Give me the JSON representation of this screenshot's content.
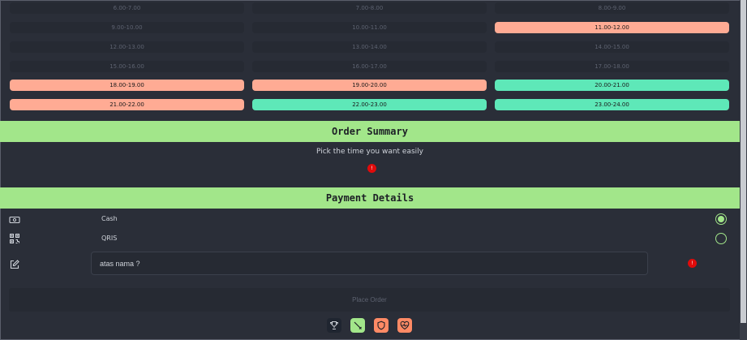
{
  "slots": [
    {
      "label": "6.00-7.00",
      "state": "disabled"
    },
    {
      "label": "7.00-8.00",
      "state": "disabled"
    },
    {
      "label": "8.00-9.00",
      "state": "disabled"
    },
    {
      "label": "9.00-10.00",
      "state": "disabled"
    },
    {
      "label": "10.00-11.00",
      "state": "disabled"
    },
    {
      "label": "11.00-12.00",
      "state": "booked"
    },
    {
      "label": "12.00-13.00",
      "state": "disabled"
    },
    {
      "label": "13.00-14.00",
      "state": "disabled"
    },
    {
      "label": "14.00-15.00",
      "state": "disabled"
    },
    {
      "label": "15.00-16.00",
      "state": "disabled"
    },
    {
      "label": "16.00-17.00",
      "state": "disabled"
    },
    {
      "label": "17.00-18.00",
      "state": "disabled"
    },
    {
      "label": "18.00-19.00",
      "state": "booked"
    },
    {
      "label": "19.00-20.00",
      "state": "booked"
    },
    {
      "label": "20.00-21.00",
      "state": "open"
    },
    {
      "label": "21.00-22.00",
      "state": "booked"
    },
    {
      "label": "22.00-23.00",
      "state": "open"
    },
    {
      "label": "23.00-24.00",
      "state": "open"
    }
  ],
  "order_summary": {
    "title": "Order Summary",
    "hint": "Pick the time you want easily",
    "badge": "!"
  },
  "payment": {
    "title": "Payment Details",
    "methods": [
      {
        "label": "Cash",
        "icon": "cash-icon",
        "selected": true
      },
      {
        "label": "QRIS",
        "icon": "qr-code-icon",
        "selected": false
      }
    ],
    "name_placeholder": "atas nama ?",
    "name_icon": "edit-icon",
    "badge": "!"
  },
  "place_order_label": "Place Order",
  "bottom_nav": [
    {
      "icon": "trophy-icon",
      "color": "#1f2530"
    },
    {
      "icon": "sword-icon",
      "color": "#a2e68a"
    },
    {
      "icon": "shield-icon",
      "color": "#ff8a65"
    },
    {
      "icon": "heart-pulse-icon",
      "color": "#ff8a65"
    }
  ],
  "colors": {
    "background": "#2a2e38",
    "accent_green": "#a2e68a",
    "booked": "#ffab94",
    "open": "#5ee8b8",
    "alert": "#e00b0b"
  }
}
